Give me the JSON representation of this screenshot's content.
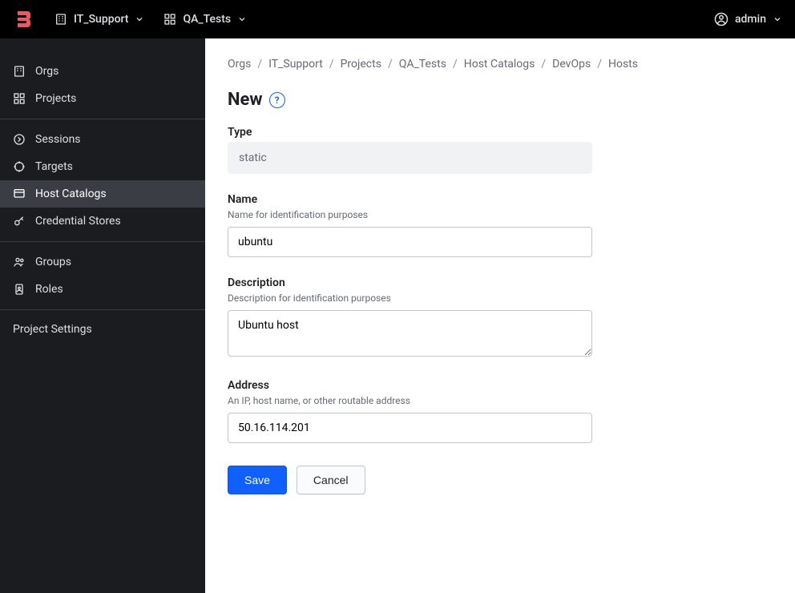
{
  "topbar": {
    "org": "IT_Support",
    "project": "QA_Tests",
    "user": "admin"
  },
  "sidebar": {
    "groups": [
      {
        "items": [
          {
            "id": "orgs",
            "label": "Orgs",
            "icon": "org-icon"
          },
          {
            "id": "projects",
            "label": "Projects",
            "icon": "projects-icon"
          }
        ]
      },
      {
        "items": [
          {
            "id": "sessions",
            "label": "Sessions",
            "icon": "sessions-icon"
          },
          {
            "id": "targets",
            "label": "Targets",
            "icon": "targets-icon"
          },
          {
            "id": "host-catalogs",
            "label": "Host Catalogs",
            "icon": "host-catalogs-icon",
            "active": true
          },
          {
            "id": "credential-stores",
            "label": "Credential Stores",
            "icon": "key-icon"
          }
        ]
      },
      {
        "items": [
          {
            "id": "groups",
            "label": "Groups",
            "icon": "groups-icon"
          },
          {
            "id": "roles",
            "label": "Roles",
            "icon": "roles-icon"
          }
        ]
      }
    ],
    "settings": "Project Settings"
  },
  "breadcrumb": [
    "Orgs",
    "IT_Support",
    "Projects",
    "QA_Tests",
    "Host Catalogs",
    "DevOps",
    "Hosts"
  ],
  "page": {
    "title": "New",
    "type_label": "Type",
    "type_value": "static",
    "name_label": "Name",
    "name_helper": "Name for identification purposes",
    "name_value": "ubuntu",
    "desc_label": "Description",
    "desc_helper": "Description for identification purposes",
    "desc_value": "Ubuntu host",
    "addr_label": "Address",
    "addr_helper": "An IP, host name, or other routable address",
    "addr_value": "50.16.114.201",
    "save": "Save",
    "cancel": "Cancel"
  }
}
